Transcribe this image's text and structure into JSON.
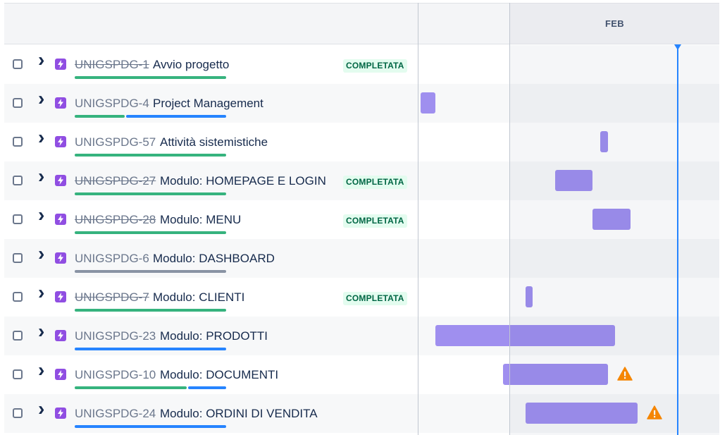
{
  "timeline": {
    "month_label": "FEB"
  },
  "colors": {
    "done": "#36b37e",
    "in_progress": "#2684ff",
    "todo": "#8993a4",
    "bar": "#9f8fef",
    "today": "#2684ff",
    "warning": "#ff8b00"
  },
  "rows": [
    {
      "key": "UNIGSPDG-1",
      "summary": "Avvio progetto",
      "done": true,
      "status": "COMPLETATA",
      "progress": {
        "done": 1,
        "in_progress": 0,
        "todo": 0
      },
      "warning": false
    },
    {
      "key": "UNIGSPDG-4",
      "summary": "Project Management",
      "done": false,
      "status": "",
      "progress": {
        "done": 0.33,
        "in_progress": 0.67,
        "todo": 0
      },
      "warning": false
    },
    {
      "key": "UNIGSPDG-57",
      "summary": "Attività sistemistiche",
      "done": false,
      "status": "",
      "progress": {
        "done": 1,
        "in_progress": 0,
        "todo": 0
      },
      "warning": false
    },
    {
      "key": "UNIGSPDG-27",
      "summary": "Modulo: HOMEPAGE E LOGIN",
      "done": true,
      "status": "COMPLETATA",
      "progress": {
        "done": 1,
        "in_progress": 0,
        "todo": 0
      },
      "warning": false
    },
    {
      "key": "UNIGSPDG-28",
      "summary": "Modulo: MENU",
      "done": true,
      "status": "COMPLETATA",
      "progress": {
        "done": 1,
        "in_progress": 0,
        "todo": 0
      },
      "warning": false
    },
    {
      "key": "UNIGSPDG-6",
      "summary": "Modulo: DASHBOARD",
      "done": false,
      "status": "",
      "progress": {
        "done": 0,
        "in_progress": 0,
        "todo": 1
      },
      "warning": false
    },
    {
      "key": "UNIGSPDG-7",
      "summary": "Modulo: CLIENTI",
      "done": true,
      "status": "COMPLETATA",
      "progress": {
        "done": 1,
        "in_progress": 0,
        "todo": 0
      },
      "warning": false
    },
    {
      "key": "UNIGSPDG-23",
      "summary": "Modulo: PRODOTTI",
      "done": false,
      "status": "",
      "progress": {
        "done": 0,
        "in_progress": 1,
        "todo": 0
      },
      "warning": false
    },
    {
      "key": "UNIGSPDG-10",
      "summary": "Modulo: DOCUMENTI",
      "done": false,
      "status": "",
      "progress": {
        "done": 0.74,
        "in_progress": 0.26,
        "todo": 0
      },
      "warning": true
    },
    {
      "key": "UNIGSPDG-24",
      "summary": "Modulo: ORDINI DI VENDITA",
      "done": false,
      "status": "",
      "progress": {
        "done": 0,
        "in_progress": 1,
        "todo": 0
      },
      "warning": true
    }
  ]
}
